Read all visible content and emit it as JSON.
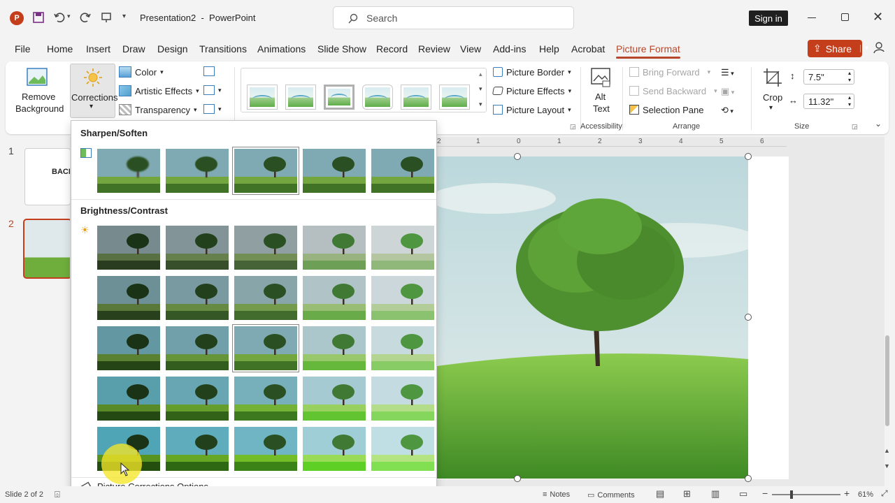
{
  "app": {
    "doc_title": "Presentation2",
    "app_name": "PowerPoint",
    "separator": "-"
  },
  "search": {
    "placeholder": "Search"
  },
  "signin": "Sign in",
  "share": "Share",
  "tabs": [
    "File",
    "Home",
    "Insert",
    "Draw",
    "Design",
    "Transitions",
    "Animations",
    "Slide Show",
    "Record",
    "Review",
    "View",
    "Add-ins",
    "Help",
    "Acrobat",
    "Picture Format"
  ],
  "ribbon": {
    "remove_bg": [
      "Remove",
      "Background"
    ],
    "corrections": "Corrections",
    "color": "Color",
    "artistic": "Artistic Effects",
    "transparency": "Transparency",
    "picture_border": "Picture Border",
    "picture_effects": "Picture Effects",
    "picture_layout": "Picture Layout",
    "alt_text": [
      "Alt",
      "Text"
    ],
    "accessibility": "Accessibility",
    "bring_forward": "Bring Forward",
    "send_backward": "Send Backward",
    "selection_pane": "Selection Pane",
    "arrange": "Arrange",
    "crop": "Crop",
    "height": "7.5\"",
    "width": "11.32\"",
    "size": "Size"
  },
  "slides": [
    {
      "num": "1",
      "title_snip": "BACK"
    },
    {
      "num": "2"
    }
  ],
  "ruler": [
    "2",
    "1",
    "0",
    "1",
    "2",
    "3",
    "4",
    "5",
    "6"
  ],
  "dropdown": {
    "sharpen_title": "Sharpen/Soften",
    "brightness_title": "Brightness/Contrast",
    "options_link": "Picture Corrections Options..."
  },
  "status": {
    "slide": "Slide 2 of 2",
    "notes": "Notes",
    "comments": "Comments",
    "zoom": "61%"
  },
  "colors": {
    "accent": "#b7472a",
    "share": "#c43e1c"
  }
}
